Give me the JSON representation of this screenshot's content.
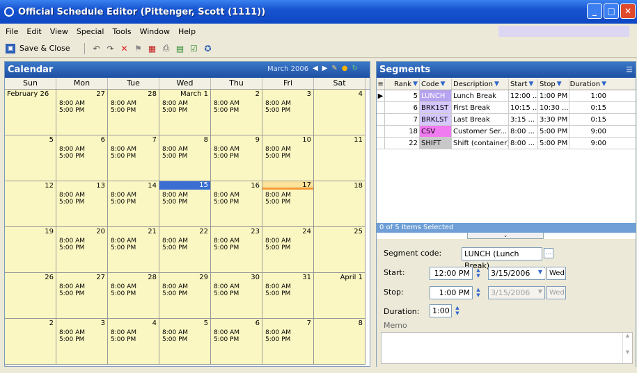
{
  "window": {
    "title": "Official Schedule Editor (Pittenger, Scott (1111))"
  },
  "menu": [
    "File",
    "Edit",
    "View",
    "Special",
    "Tools",
    "Window",
    "Help"
  ],
  "toolbar": {
    "save_label": "Save & Close"
  },
  "calendar": {
    "title": "Calendar",
    "month_label": "March 2006",
    "days": [
      "Sun",
      "Mon",
      "Tue",
      "Wed",
      "Thu",
      "Fri",
      "Sat"
    ],
    "weeks": [
      [
        {
          "d": "February 26",
          "t": []
        },
        {
          "d": "27",
          "t": [
            "8:00 AM",
            "5:00 PM"
          ]
        },
        {
          "d": "28",
          "t": [
            "8:00 AM",
            "5:00 PM"
          ]
        },
        {
          "d": "March 1",
          "t": [
            "8:00 AM",
            "5:00 PM"
          ]
        },
        {
          "d": "2",
          "t": [
            "8:00 AM",
            "5:00 PM"
          ]
        },
        {
          "d": "3",
          "t": [
            "8:00 AM",
            "5:00 PM"
          ]
        },
        {
          "d": "4",
          "t": []
        }
      ],
      [
        {
          "d": "5",
          "t": []
        },
        {
          "d": "6",
          "t": [
            "8:00 AM",
            "5:00 PM"
          ]
        },
        {
          "d": "7",
          "t": [
            "8:00 AM",
            "5:00 PM"
          ]
        },
        {
          "d": "8",
          "t": [
            "8:00 AM",
            "5:00 PM"
          ]
        },
        {
          "d": "9",
          "t": [
            "8:00 AM",
            "5:00 PM"
          ]
        },
        {
          "d": "10",
          "t": [
            "8:00 AM",
            "5:00 PM"
          ]
        },
        {
          "d": "11",
          "t": []
        }
      ],
      [
        {
          "d": "12",
          "t": []
        },
        {
          "d": "13",
          "t": [
            "8:00 AM",
            "5:00 PM"
          ]
        },
        {
          "d": "14",
          "t": [
            "8:00 AM",
            "5:00 PM"
          ]
        },
        {
          "d": "15",
          "t": [
            "8:00 AM",
            "5:00 PM"
          ],
          "state": "selected"
        },
        {
          "d": "16",
          "t": [
            "8:00 AM",
            "5:00 PM"
          ]
        },
        {
          "d": "17",
          "t": [
            "8:00 AM",
            "5:00 PM"
          ],
          "state": "today"
        },
        {
          "d": "18",
          "t": []
        }
      ],
      [
        {
          "d": "19",
          "t": []
        },
        {
          "d": "20",
          "t": [
            "8:00 AM",
            "5:00 PM"
          ]
        },
        {
          "d": "21",
          "t": [
            "8:00 AM",
            "5:00 PM"
          ]
        },
        {
          "d": "22",
          "t": [
            "8:00 AM",
            "5:00 PM"
          ]
        },
        {
          "d": "23",
          "t": [
            "8:00 AM",
            "5:00 PM"
          ]
        },
        {
          "d": "24",
          "t": [
            "8:00 AM",
            "5:00 PM"
          ]
        },
        {
          "d": "25",
          "t": []
        }
      ],
      [
        {
          "d": "26",
          "t": []
        },
        {
          "d": "27",
          "t": [
            "8:00 AM",
            "5:00 PM"
          ]
        },
        {
          "d": "28",
          "t": [
            "8:00 AM",
            "5:00 PM"
          ]
        },
        {
          "d": "29",
          "t": [
            "8:00 AM",
            "5:00 PM"
          ]
        },
        {
          "d": "30",
          "t": [
            "8:00 AM",
            "5:00 PM"
          ]
        },
        {
          "d": "31",
          "t": [
            "8:00 AM",
            "5:00 PM"
          ]
        },
        {
          "d": "April 1",
          "t": []
        }
      ],
      [
        {
          "d": "2",
          "t": []
        },
        {
          "d": "3",
          "t": [
            "8:00 AM",
            "5:00 PM"
          ]
        },
        {
          "d": "4",
          "t": [
            "8:00 AM",
            "5:00 PM"
          ]
        },
        {
          "d": "5",
          "t": [
            "8:00 AM",
            "5:00 PM"
          ]
        },
        {
          "d": "6",
          "t": [
            "8:00 AM",
            "5:00 PM"
          ]
        },
        {
          "d": "7",
          "t": [
            "8:00 AM",
            "5:00 PM"
          ]
        },
        {
          "d": "8",
          "t": []
        }
      ]
    ]
  },
  "segments": {
    "title": "Segments",
    "columns": [
      "Rank",
      "Code",
      "Description",
      "Start",
      "Stop",
      "Duration"
    ],
    "rows": [
      {
        "rank": "5",
        "code": "LUNCH",
        "desc": "Lunch Break",
        "start": "12:00 ...",
        "stop": "1:00 PM",
        "dur": "1:00",
        "color": "#b7a3f0"
      },
      {
        "rank": "6",
        "code": "BRK1ST",
        "desc": "First Break",
        "start": "10:15 ...",
        "stop": "10:30 ...",
        "dur": "0:15",
        "color": "#d6c8ff"
      },
      {
        "rank": "7",
        "code": "BRKLST",
        "desc": "Last Break",
        "start": "3:15 ...",
        "stop": "3:30 PM",
        "dur": "0:15",
        "color": "#d6c8ff"
      },
      {
        "rank": "18",
        "code": "CSV",
        "desc": "Customer Ser...",
        "start": "8:00 ...",
        "stop": "5:00 PM",
        "dur": "9:00",
        "color": "#f07af0"
      },
      {
        "rank": "22",
        "code": "SHIFT",
        "desc": "Shift (container)",
        "start": "8:00 ...",
        "stop": "5:00 PM",
        "dur": "9:00",
        "color": "#c8c8c8"
      }
    ],
    "status": "0 of 5 Items Selected"
  },
  "details": {
    "segment_code_label": "Segment code:",
    "segment_code_value": "LUNCH (Lunch Break)",
    "start_label": "Start:",
    "start_time": "12:00 PM",
    "start_date": "3/15/2006",
    "start_day": "Wed",
    "stop_label": "Stop:",
    "stop_time": "1:00 PM",
    "stop_date": "3/15/2006",
    "stop_day": "Wed",
    "duration_label": "Duration:",
    "duration_value": "1:00",
    "memo_label": "Memo"
  }
}
